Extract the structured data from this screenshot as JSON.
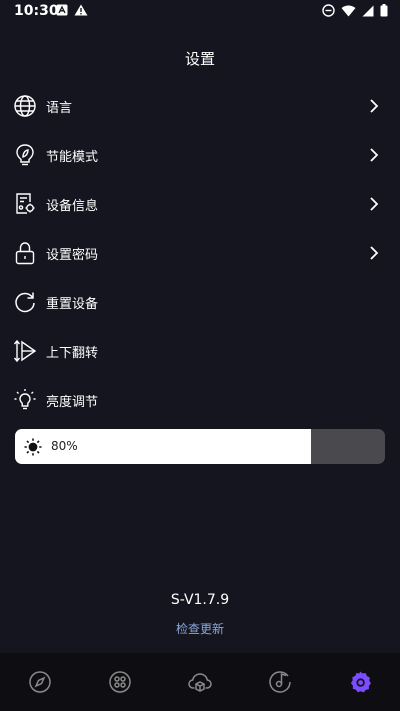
{
  "status_bar": {
    "time": "10:30"
  },
  "header": {
    "title": "设置"
  },
  "menu": [
    {
      "label": "语言",
      "icon": "globe-icon",
      "has_chevron": true
    },
    {
      "label": "节能模式",
      "icon": "lightbulb-leaf-icon",
      "has_chevron": true
    },
    {
      "label": "设备信息",
      "icon": "device-info-icon",
      "has_chevron": true
    },
    {
      "label": "设置密码",
      "icon": "lock-icon",
      "has_chevron": true
    },
    {
      "label": "重置设备",
      "icon": "refresh-icon",
      "has_chevron": false
    },
    {
      "label": "上下翻转",
      "icon": "flip-icon",
      "has_chevron": false
    },
    {
      "label": "亮度调节",
      "icon": "bulb-icon",
      "has_chevron": false
    }
  ],
  "brightness": {
    "value_label": "80%",
    "level": 0.8,
    "icon": "sun-icon"
  },
  "footer": {
    "version": "S-V1.7.9",
    "check_update": "检查更新"
  },
  "bottom_nav": {
    "items": [
      "compass-icon",
      "grid-icon",
      "cloud-box-icon",
      "music-disc-icon",
      "settings-gear-icon"
    ],
    "active_color": "#7b4dff",
    "inactive_color": "#8a8a8a"
  },
  "colors": {
    "background": "#15151f",
    "slider_fill": "#ffffff",
    "slider_track": "#4a4a4e",
    "link": "#8aa8d8"
  }
}
